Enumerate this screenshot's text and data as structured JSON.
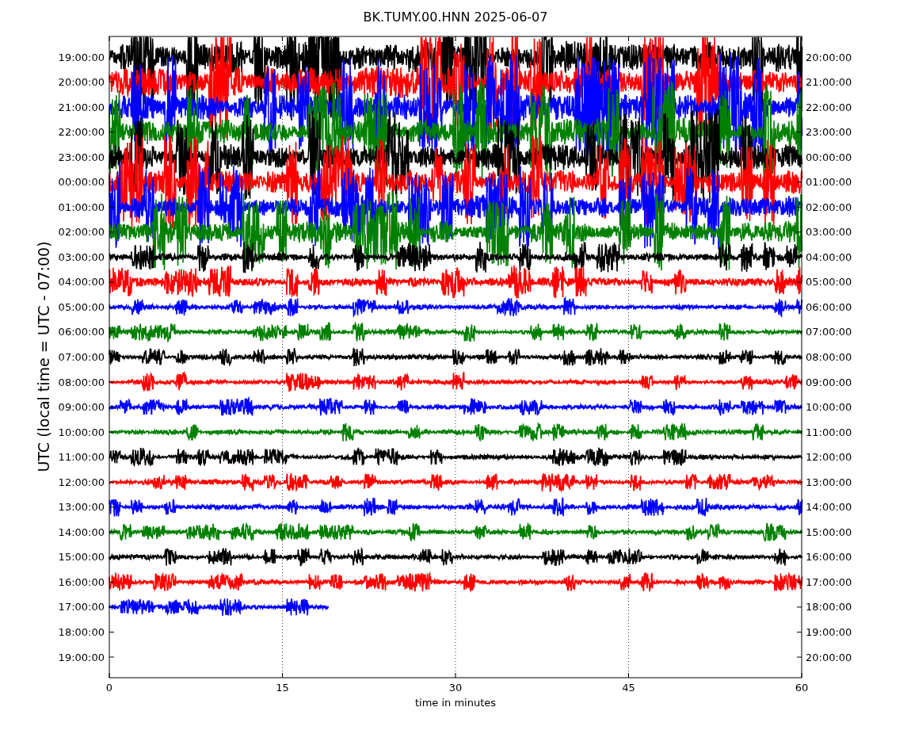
{
  "title": "BK.TUMY.00.HNN 2025-06-07",
  "ylabel": "UTC (local time = UTC - 07:00)",
  "xlabel": "time in minutes",
  "xticks": [
    "0",
    "15",
    "30",
    "45",
    "60"
  ],
  "rows": [
    {
      "left": "19:00:00",
      "right": "20:00:00",
      "color": "#000000",
      "kind": "full"
    },
    {
      "left": "20:00:00",
      "right": "21:00:00",
      "color": "#ff0000",
      "kind": "full"
    },
    {
      "left": "21:00:00",
      "right": "22:00:00",
      "color": "#0000ff",
      "kind": "full"
    },
    {
      "left": "22:00:00",
      "right": "23:00:00",
      "color": "#008000",
      "kind": "full"
    },
    {
      "left": "23:00:00",
      "right": "00:00:00",
      "color": "#000000",
      "kind": "full"
    },
    {
      "left": "00:00:00",
      "right": "01:00:00",
      "color": "#ff0000",
      "kind": "full"
    },
    {
      "left": "01:00:00",
      "right": "02:00:00",
      "color": "#0000ff",
      "kind": "full"
    },
    {
      "left": "02:00:00",
      "right": "03:00:00",
      "color": "#008000",
      "kind": "full"
    },
    {
      "left": "03:00:00",
      "right": "04:00:00",
      "color": "#000000",
      "kind": "full"
    },
    {
      "left": "04:00:00",
      "right": "05:00:00",
      "color": "#ff0000",
      "kind": "full"
    },
    {
      "left": "05:00:00",
      "right": "06:00:00",
      "color": "#0000ff",
      "kind": "full"
    },
    {
      "left": "06:00:00",
      "right": "07:00:00",
      "color": "#008000",
      "kind": "full"
    },
    {
      "left": "07:00:00",
      "right": "08:00:00",
      "color": "#000000",
      "kind": "full"
    },
    {
      "left": "08:00:00",
      "right": "09:00:00",
      "color": "#ff0000",
      "kind": "full"
    },
    {
      "left": "09:00:00",
      "right": "10:00:00",
      "color": "#0000ff",
      "kind": "full"
    },
    {
      "left": "10:00:00",
      "right": "11:00:00",
      "color": "#008000",
      "kind": "full"
    },
    {
      "left": "11:00:00",
      "right": "12:00:00",
      "color": "#000000",
      "kind": "full"
    },
    {
      "left": "12:00:00",
      "right": "13:00:00",
      "color": "#ff0000",
      "kind": "full"
    },
    {
      "left": "13:00:00",
      "right": "14:00:00",
      "color": "#0000ff",
      "kind": "full"
    },
    {
      "left": "14:00:00",
      "right": "15:00:00",
      "color": "#008000",
      "kind": "full"
    },
    {
      "left": "15:00:00",
      "right": "16:00:00",
      "color": "#000000",
      "kind": "full"
    },
    {
      "left": "16:00:00",
      "right": "17:00:00",
      "color": "#ff0000",
      "kind": "full"
    },
    {
      "left": "17:00:00",
      "right": "18:00:00",
      "color": "#0000ff",
      "kind": "partial"
    },
    {
      "left": "18:00:00",
      "right": "19:00:00",
      "kind": "empty"
    },
    {
      "left": "19:00:00",
      "right": "20:00:00",
      "kind": "empty"
    }
  ]
}
